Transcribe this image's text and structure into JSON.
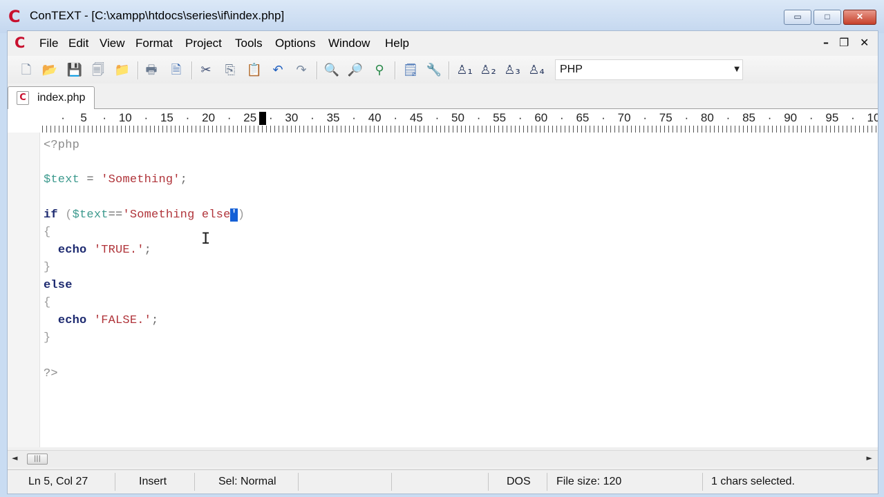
{
  "window": {
    "title": "ConTEXT - [C:\\xampp\\htdocs\\series\\if\\index.php]",
    "app_logo": "C",
    "min_glyph": "▭",
    "max_glyph": "□",
    "close_glyph": "✕"
  },
  "menu": {
    "logo": "C",
    "items": [
      "File",
      "Edit",
      "View",
      "Format",
      "Project",
      "Tools",
      "Options",
      "Window",
      "Help"
    ],
    "mdi_minimize": "–",
    "mdi_restore": "❐",
    "mdi_close": "✕"
  },
  "toolbar": {
    "icons": [
      {
        "name": "new-file-icon",
        "glyph": "🗋",
        "color": "#7a8aa0"
      },
      {
        "name": "open-file-icon",
        "glyph": "📂",
        "color": "#e0a020"
      },
      {
        "name": "save-icon",
        "glyph": "💾",
        "color": "#6a7a90"
      },
      {
        "name": "save-all-icon",
        "glyph": "🗐",
        "color": "#6a7a90"
      },
      {
        "name": "open-folder-icon",
        "glyph": "📁",
        "color": "#e0b030"
      },
      {
        "name": "print-icon",
        "glyph": "🖶",
        "color": "#6a7a90"
      },
      {
        "name": "print-preview-icon",
        "glyph": "🗎",
        "color": "#3a6ab0"
      },
      {
        "name": "cut-icon",
        "glyph": "✂",
        "color": "#3a4a70"
      },
      {
        "name": "copy-icon",
        "glyph": "⎘",
        "color": "#6a7a90"
      },
      {
        "name": "paste-icon",
        "glyph": "📋",
        "color": "#a08040"
      },
      {
        "name": "undo-icon",
        "glyph": "↶",
        "color": "#2060c0"
      },
      {
        "name": "redo-icon",
        "glyph": "↷",
        "color": "#7a8aa0"
      },
      {
        "name": "find-icon",
        "glyph": "🔍",
        "color": "#3a6ab0"
      },
      {
        "name": "find-next-icon",
        "glyph": "🔎",
        "color": "#3a6ab0"
      },
      {
        "name": "replace-icon",
        "glyph": "⚲",
        "color": "#2a8a4a"
      },
      {
        "name": "document-properties-icon",
        "glyph": "🗒",
        "color": "#3a6ab0"
      },
      {
        "name": "tools-icon",
        "glyph": "🔧",
        "color": "#3a6ab0"
      },
      {
        "name": "user-command-1-icon",
        "glyph": "♙₁",
        "color": "#2a3a60"
      },
      {
        "name": "user-command-2-icon",
        "glyph": "♙₂",
        "color": "#2a3a60"
      },
      {
        "name": "user-command-3-icon",
        "glyph": "♙₃",
        "color": "#2a3a60"
      },
      {
        "name": "user-command-4-icon",
        "glyph": "♙₄",
        "color": "#2a3a60"
      }
    ],
    "highlighter": {
      "value": "PHP",
      "arrow": "▼"
    }
  },
  "tabs": [
    {
      "label": "index.php",
      "icon": "C"
    }
  ],
  "ruler": {
    "numbers": [
      "5",
      "10",
      "15",
      "20",
      "25",
      "30",
      "35",
      "40",
      "45",
      "50",
      "55",
      "60",
      "65",
      "70",
      "75",
      "80",
      "85",
      "90",
      "95",
      "10"
    ],
    "caret_column": 27
  },
  "editor": {
    "lines": [
      {
        "segs": [
          {
            "t": "<?php",
            "c": "tag"
          }
        ]
      },
      {
        "segs": []
      },
      {
        "segs": [
          {
            "t": "$text",
            "c": "var"
          },
          {
            "t": " = ",
            "c": "op"
          },
          {
            "t": "'Something'",
            "c": "str"
          },
          {
            "t": ";",
            "c": "op"
          }
        ]
      },
      {
        "segs": []
      },
      {
        "segs": [
          {
            "t": "if",
            "c": "kw"
          },
          {
            "t": " (",
            "c": "brace"
          },
          {
            "t": "$text",
            "c": "var"
          },
          {
            "t": "==",
            "c": "op"
          },
          {
            "t": "'Something else",
            "c": "str"
          },
          {
            "t": "'",
            "c": "sel"
          },
          {
            "t": ")",
            "c": "brace"
          }
        ]
      },
      {
        "segs": [
          {
            "t": "{",
            "c": "brace"
          }
        ]
      },
      {
        "segs": [
          {
            "t": "  ",
            "c": "op"
          },
          {
            "t": "echo",
            "c": "kw"
          },
          {
            "t": " ",
            "c": "op"
          },
          {
            "t": "'TRUE.'",
            "c": "str"
          },
          {
            "t": ";",
            "c": "op"
          }
        ]
      },
      {
        "segs": [
          {
            "t": "}",
            "c": "brace"
          }
        ]
      },
      {
        "segs": [
          {
            "t": "else",
            "c": "kw"
          }
        ]
      },
      {
        "segs": [
          {
            "t": "{",
            "c": "brace"
          }
        ]
      },
      {
        "segs": [
          {
            "t": "  ",
            "c": "op"
          },
          {
            "t": "echo",
            "c": "kw"
          },
          {
            "t": " ",
            "c": "op"
          },
          {
            "t": "'FALSE.'",
            "c": "str"
          },
          {
            "t": ";",
            "c": "op"
          }
        ]
      },
      {
        "segs": [
          {
            "t": "}",
            "c": "brace"
          }
        ]
      },
      {
        "segs": []
      },
      {
        "segs": [
          {
            "t": "?>",
            "c": "tag"
          }
        ]
      }
    ]
  },
  "scrollbar": {
    "left_arrow": "◄",
    "right_arrow": "►",
    "thumb_grip": "|||"
  },
  "status": {
    "position": "Ln 5, Col 27",
    "mode": "Insert",
    "selection_mode": "Sel: Normal",
    "line_ending": "DOS",
    "file_size": "File size: 120",
    "selection_info": "1 chars selected."
  }
}
